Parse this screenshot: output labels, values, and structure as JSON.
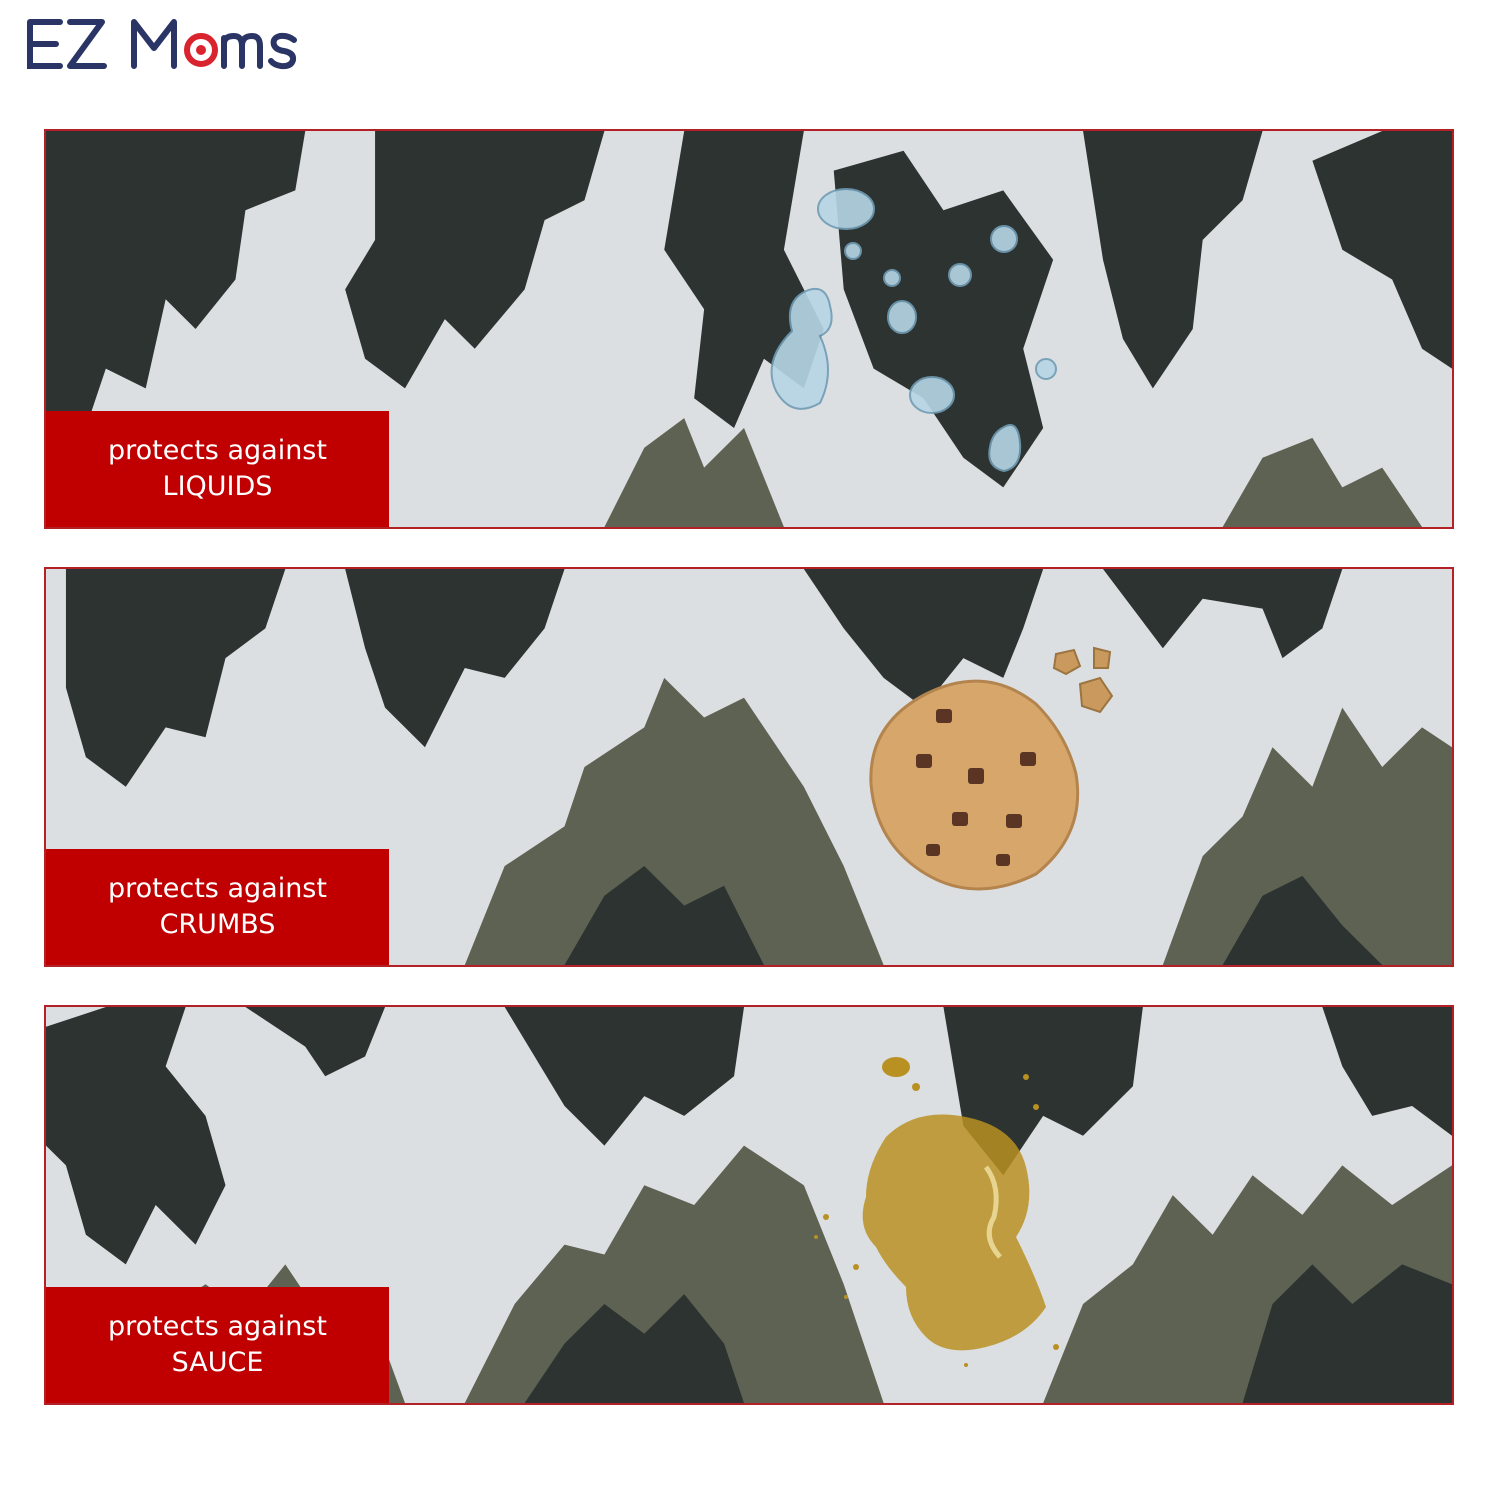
{
  "brand": {
    "name": "EZ Moms",
    "text_color": "#2a3566",
    "accent_color": "#d9232e"
  },
  "panels": [
    {
      "line1": "protects against",
      "line2": "LIQUIDS",
      "illustration": "water-droplets"
    },
    {
      "line1": "protects against",
      "line2": "CRUMBS",
      "illustration": "chocolate-chip-cookie"
    },
    {
      "line1": "protects against",
      "line2": "SAUCE",
      "illustration": "sauce-spill"
    }
  ],
  "colors": {
    "label_bg": "#c00000",
    "panel_border": "#b32025",
    "camo_light": "#dcdfe1",
    "camo_dark": "#2d3330",
    "camo_olive": "#5d6253"
  }
}
